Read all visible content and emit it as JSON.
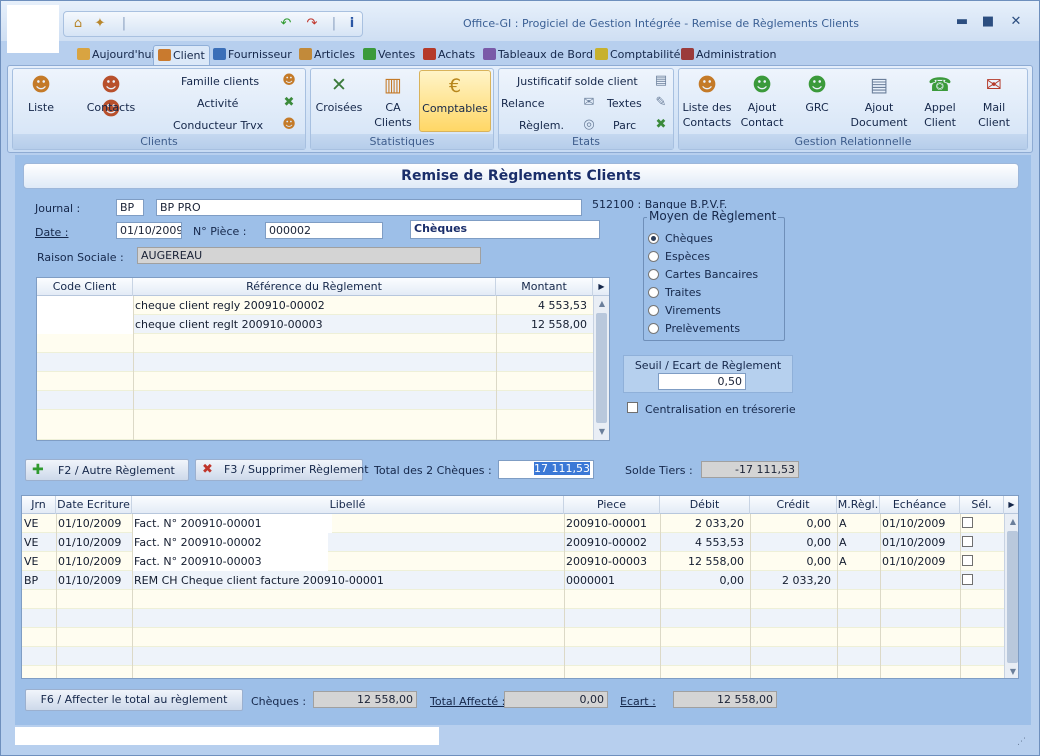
{
  "window": {
    "title": "Office-GI : Progiciel de Gestion Intégrée - Remise de Règlements Clients",
    "minimize": "▬",
    "maximize": "■",
    "close": "✕"
  },
  "quick_access": [
    "home-icon",
    "settings-icon",
    "undo-icon",
    "redo-icon",
    "info-icon"
  ],
  "menu_tabs": [
    {
      "label": "Aujourd'hui",
      "icon": "house-icon",
      "color": "#d9a441"
    },
    {
      "label": "Client",
      "icon": "person-icon",
      "color": "#c97a2e",
      "active": true
    },
    {
      "label": "Fournisseur",
      "icon": "person-icon",
      "color": "#3b6fb8"
    },
    {
      "label": "Articles",
      "icon": "box-icon",
      "color": "#c28a3a"
    },
    {
      "label": "Ventes",
      "icon": "leaf-icon",
      "color": "#3b9a3b"
    },
    {
      "label": "Achats",
      "icon": "cart-icon",
      "color": "#b53a2a"
    },
    {
      "label": "Tableaux de Bord",
      "icon": "calendar-icon",
      "color": "#7a5aa8"
    },
    {
      "label": "Comptabilité",
      "icon": "calculator-icon",
      "color": "#c7b12e"
    },
    {
      "label": "Administration",
      "icon": "admin-icon",
      "color": "#9b3b3b"
    }
  ],
  "ribbon": {
    "clients": {
      "label": "Clients",
      "liste": "Liste",
      "contacts": "Contacts",
      "famille": "Famille clients",
      "activite": "Activité",
      "conducteur": "Conducteur Trvx"
    },
    "statistiques": {
      "label": "Statistiques",
      "croisees": "Croisées",
      "ca_clients_1": "CA",
      "ca_clients_2": "Clients",
      "comptables": "Comptables"
    },
    "etats": {
      "label": "Etats",
      "justificatif": "Justificatif solde client",
      "relance": "Relance",
      "textes": "Textes",
      "reglem": "Règlem.",
      "parc": "Parc"
    },
    "gestion": {
      "label": "Gestion Relationnelle",
      "liste_contacts_1": "Liste des",
      "liste_contacts_2": "Contacts",
      "ajout_contact_1": "Ajout",
      "ajout_contact_2": "Contact",
      "grc": "GRC",
      "ajout_doc_1": "Ajout",
      "ajout_doc_2": "Document",
      "appel_1": "Appel",
      "appel_2": "Client",
      "mail_1": "Mail",
      "mail_2": "Client"
    }
  },
  "form": {
    "title": "Remise de Règlements Clients",
    "journal_label": "Journal :",
    "journal_code": "BP",
    "journal_name": "BP PRO",
    "bank_account": "512100 : Banque B.P.V.F.",
    "date_label": "Date :",
    "date_value": "01/10/2009",
    "piece_label": "N° Pièce :",
    "piece_value": "000002",
    "payment_type": "Chèques",
    "raison_label": "Raison Sociale :",
    "raison_value": "AUGEREAU"
  },
  "moyen": {
    "legend": "Moyen de Règlement",
    "options": [
      "Chèques",
      "Espèces",
      "Cartes Bancaires",
      "Traites",
      "Virements",
      "Prelèvements"
    ],
    "selected": 0
  },
  "seuil": {
    "label": "Seuil / Ecart de Règlement",
    "value": "0,50"
  },
  "centralisation_label": "Centralisation en trésorerie",
  "reglements": {
    "headers": [
      "Code Client",
      "Référence du Règlement",
      "Montant"
    ],
    "rows": [
      {
        "code": "",
        "ref": "cheque client regly 200910-00002",
        "montant": "4 553,53"
      },
      {
        "code": "",
        "ref": "cheque client reglt 200910-00003",
        "montant": "12 558,00"
      }
    ]
  },
  "actions": {
    "f2": "F2 / Autre Règlement",
    "f3": "F3 / Supprimer Règlement",
    "total_label": "Total des 2 Chèques :",
    "total_value": "17 111,53",
    "solde_label": "Solde Tiers :",
    "solde_value": "-17 111,53"
  },
  "ecritures": {
    "headers": [
      "Jrn",
      "Date Ecriture",
      "Libellé",
      "Piece",
      "Débit",
      "Crédit",
      "M.Règl.",
      "Echéance",
      "Sél."
    ],
    "rows": [
      {
        "jrn": "VE",
        "date": "01/10/2009",
        "libelle": "Fact. N° 200910-00001",
        "piece": "200910-00001",
        "debit": "2 033,20",
        "credit": "0,00",
        "mregl": "A",
        "echeance": "01/10/2009",
        "sel": true
      },
      {
        "jrn": "VE",
        "date": "01/10/2009",
        "libelle": "Fact. N° 200910-00002",
        "piece": "200910-00002",
        "debit": "4 553,53",
        "credit": "0,00",
        "mregl": "A",
        "echeance": "01/10/2009",
        "sel": true
      },
      {
        "jrn": "VE",
        "date": "01/10/2009",
        "libelle": "Fact. N° 200910-00003",
        "piece": "200910-00003",
        "debit": "12 558,00",
        "credit": "0,00",
        "mregl": "A",
        "echeance": "01/10/2009",
        "sel": true
      },
      {
        "jrn": "BP",
        "date": "01/10/2009",
        "libelle": "REM CH Cheque client facture 200910-00001",
        "piece": "0000001",
        "debit": "0,00",
        "credit": "2 033,20",
        "mregl": "",
        "echeance": "",
        "sel": true
      }
    ]
  },
  "footer": {
    "f6": "F6 / Affecter le total au règlement",
    "cheques_label": "Chèques :",
    "cheques_value": "12 558,00",
    "affecte_label": "Total Affecté :",
    "affecte_value": "0,00",
    "ecart_label": "Ecart :",
    "ecart_value": "12 558,00"
  }
}
